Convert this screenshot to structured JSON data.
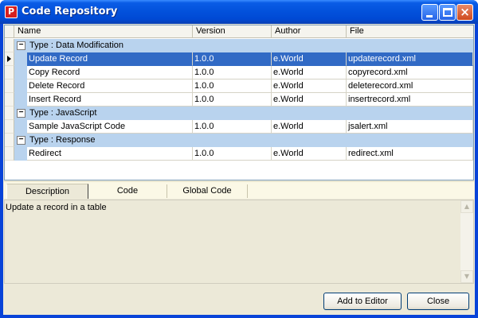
{
  "window": {
    "title": "Code Repository",
    "app_icon_letter": "P",
    "controls": {
      "minimize": "minimize",
      "maximize": "maximize",
      "close": "×"
    },
    "accent_color": "#0a5ce6"
  },
  "grid": {
    "columns": [
      "Name",
      "Version",
      "Author",
      "File"
    ],
    "groups": [
      {
        "label": "Type : Data Modification",
        "expander": "−",
        "rows": [
          {
            "name": "Update Record",
            "version": "1.0.0",
            "author": "e.World",
            "file": "updaterecord.xml",
            "selected": true
          },
          {
            "name": "Copy Record",
            "version": "1.0.0",
            "author": "e.World",
            "file": "copyrecord.xml"
          },
          {
            "name": "Delete Record",
            "version": "1.0.0",
            "author": "e.World",
            "file": "deleterecord.xml"
          },
          {
            "name": "Insert Record",
            "version": "1.0.0",
            "author": "e.World",
            "file": "insertrecord.xml"
          }
        ]
      },
      {
        "label": "Type : JavaScript",
        "expander": "−",
        "rows": [
          {
            "name": "Sample JavaScript Code",
            "version": "1.0.0",
            "author": "e.World",
            "file": "jsalert.xml"
          }
        ]
      },
      {
        "label": "Type : Response",
        "expander": "−",
        "rows": [
          {
            "name": "Redirect",
            "version": "1.0.0",
            "author": "e.World",
            "file": "redirect.xml"
          }
        ]
      }
    ],
    "selection_color": "#316ac5",
    "group_band_color": "#b9d3ee"
  },
  "tabs": [
    {
      "label": "Description",
      "active": true
    },
    {
      "label": "Code",
      "active": false
    },
    {
      "label": "Global Code",
      "active": false
    }
  ],
  "description": {
    "text": "Update a record in a table"
  },
  "buttons": {
    "add_to_editor": "Add to Editor",
    "close": "Close"
  }
}
